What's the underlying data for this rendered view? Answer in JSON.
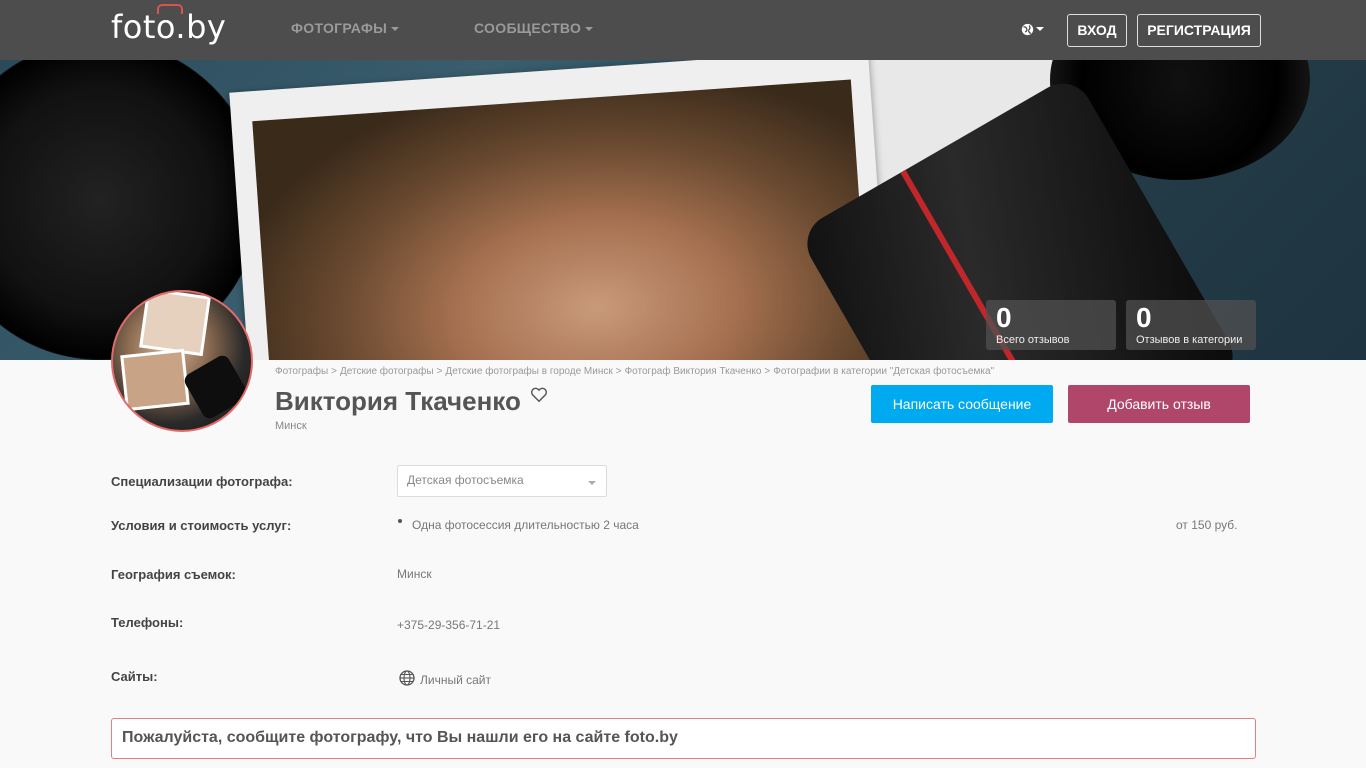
{
  "header": {
    "logo": "foto.by",
    "nav": [
      {
        "label": "ФОТОГРАФЫ"
      },
      {
        "label": "СООБЩЕСТВО"
      }
    ],
    "login_label": "ВХОД",
    "register_label": "РЕГИСТРАЦИЯ",
    "language_icon": "globe-icon"
  },
  "stats": [
    {
      "value": "0",
      "label": "Всего отзывов"
    },
    {
      "value": "0",
      "label": "Отзывов в категории"
    }
  ],
  "breadcrumb": [
    "Фотографы",
    "Детские фотографы",
    "Детские фотографы в городе Минск",
    "Фотограф Виктория Ткаченко",
    "Фотографии в категории \"Детская фотосъемка\""
  ],
  "breadcrumb_separator": ">",
  "profile": {
    "name": "Виктория Ткаченко",
    "city": "Минск"
  },
  "actions": {
    "message_label": "Написать сообщение",
    "review_label": "Добавить отзыв",
    "message_color": "#00aaf0",
    "review_color": "#b0476a"
  },
  "details": {
    "specialization_label": "Специализации фотографа:",
    "specialization_value": "Детская фотосъемка",
    "services_label": "Условия и стоимость услуг:",
    "service_item": "Одна фотосессия длительностью 2 часа",
    "service_price": "от 150 руб.",
    "geography_label": "География съемок:",
    "geography_value": "Минск",
    "phones_label": "Телефоны:",
    "phone_value": "+375-29-356-71-21",
    "sites_label": "Сайты:",
    "site_value": "Личный сайт"
  },
  "notice": "Пожалуйста, сообщите фотографу, что Вы нашли его на сайте foto.by"
}
